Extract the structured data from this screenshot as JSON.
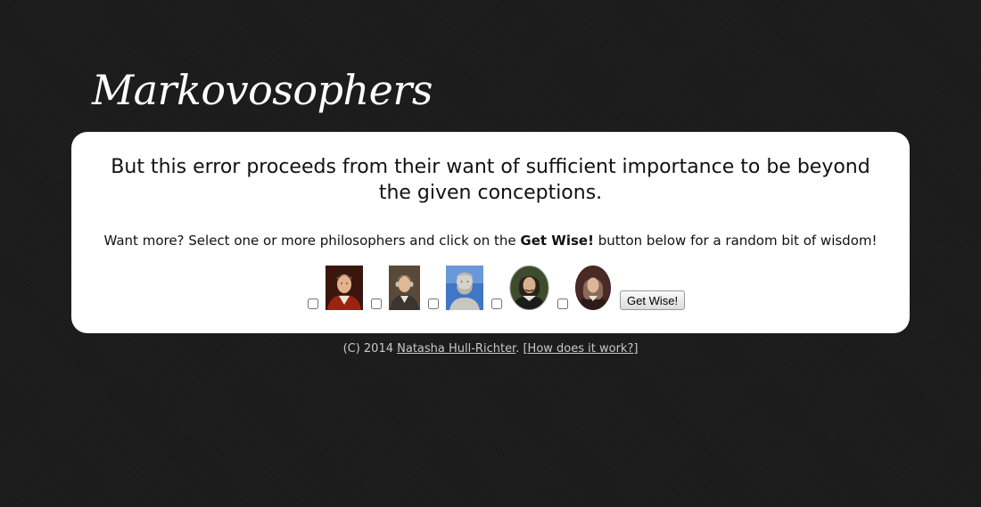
{
  "site": {
    "title": "Markovosophers"
  },
  "quote": {
    "text": "But this error proceeds from their want of sufficient importance to be beyond the given conceptions."
  },
  "prompt": {
    "before": "Want more? Select one or more philosophers and click on the ",
    "button_ref": "Get Wise!",
    "after": " button below for a random bit of wisdom!"
  },
  "philosophers": [
    {
      "icon": "philosopher-portrait-1",
      "checked": false
    },
    {
      "icon": "philosopher-portrait-2",
      "checked": false
    },
    {
      "icon": "philosopher-portrait-3",
      "checked": false
    },
    {
      "icon": "philosopher-portrait-4",
      "checked": false
    },
    {
      "icon": "philosopher-portrait-5",
      "checked": false
    }
  ],
  "actions": {
    "get_wise_label": "Get Wise!"
  },
  "footer": {
    "copyright": "(C) 2014 ",
    "author": "Natasha Hull-Richter",
    "separator": ". ",
    "how_link": "[How does it work?]"
  },
  "colors": {
    "background": "#1c1c1c",
    "card": "#ffffff",
    "footer_text": "#c8c8c8"
  }
}
